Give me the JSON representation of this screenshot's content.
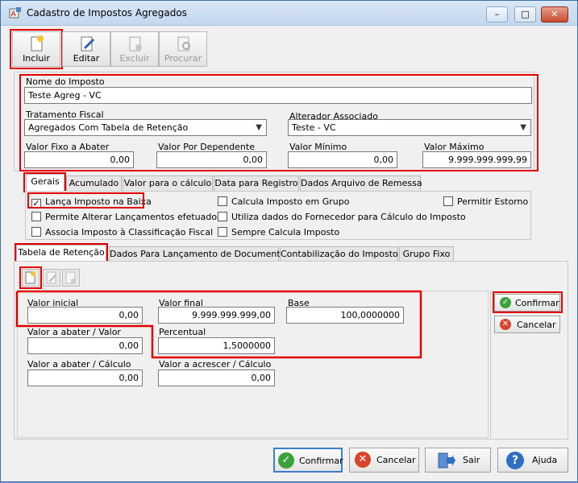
{
  "window": {
    "title": "Cadastro de Impostos Agregados"
  },
  "toolbar": {
    "incluir": "Incluir",
    "editar": "Editar",
    "excluir": "Excluir",
    "procurar": "Procurar"
  },
  "form": {
    "nome_label": "Nome do Imposto",
    "nome_value": "Teste Agreg - VC",
    "tratamento_label": "Tratamento Fiscal",
    "tratamento_value": "Agregados Com Tabela de Retenção",
    "alterador_label": "Alterador Associado",
    "alterador_value": "Teste - VC",
    "valor_fixo_label": "Valor Fixo a Abater",
    "valor_fixo_value": "0,00",
    "valor_dep_label": "Valor Por Dependente",
    "valor_dep_value": "0,00",
    "valor_min_label": "Valor Mínimo",
    "valor_min_value": "0,00",
    "valor_max_label": "Valor Máximo",
    "valor_max_value": "9.999.999.999,99"
  },
  "tabs1": [
    "Gerais",
    "Acumulado",
    "Valor para o cálculo",
    "Data para Registro",
    "Dados Arquivo de Remessa"
  ],
  "checkboxes": {
    "lanca": "Lança Imposto na Baixa",
    "calcula_grupo": "Calcula Imposto em Grupo",
    "permitir_estorno": "Permitir Estorno",
    "permite_alterar": "Permite Alterar Lançamentos efetuados",
    "utiliza_dados": "Utiliza dados do Fornecedor para Cálculo do Imposto",
    "associa": "Associa Imposto à Classificação Fiscal",
    "sempre": "Sempre Calcula Imposto"
  },
  "tabs2": [
    "Tabela de Retenção",
    "Dados Para Lançamento de Documento",
    "Contabilização do Imposto",
    "Grupo Fixo"
  ],
  "tabela": {
    "valor_inicial_label": "Valor inicial",
    "valor_inicial_value": "0,00",
    "valor_final_label": "Valor final",
    "valor_final_value": "9.999.999.999,00",
    "base_label": "Base",
    "base_value": "100,0000000",
    "valor_abater_label": "Valor a abater / Valor",
    "valor_abater_value": "0,00",
    "percentual_label": "Percentual",
    "percentual_value": "1,5000000",
    "abater_calc_label": "Valor a abater / Cálculo",
    "abater_calc_value": "0,00",
    "acrescer_label": "Valor a acrescer / Cálculo",
    "acrescer_value": "0,00",
    "confirmar": "Confirmar",
    "cancelar": "Cancelar"
  },
  "footer": {
    "confirmar": "Confirmar",
    "cancelar": "Cancelar",
    "sair": "Sair",
    "ajuda": "Ajuda"
  },
  "colors": {
    "accent_red": "#e00000",
    "confirm_green": "#3aa23a",
    "cancel_red": "#d9442b",
    "help_blue": "#2f6fc0"
  }
}
